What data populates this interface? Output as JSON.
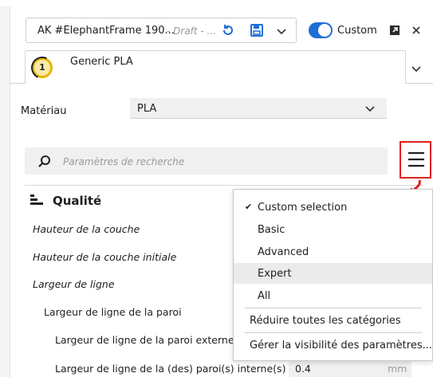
{
  "profile": {
    "name": "AK #ElephantFrame 190...",
    "state": "- Draft - ...",
    "custom_label": "Custom",
    "custom_enabled": true
  },
  "extruder_tab": {
    "badge": "1",
    "label": "Generic PLA"
  },
  "material": {
    "label": "Matériau",
    "value": "PLA"
  },
  "search": {
    "placeholder": "Paramètres de recherche"
  },
  "section": {
    "title": "Qualité"
  },
  "settings": [
    {
      "label": "Hauteur de la couche"
    },
    {
      "label": "Hauteur de la couche initiale"
    },
    {
      "label": "Largeur de ligne"
    },
    {
      "label": "Largeur de ligne de la paroi"
    },
    {
      "label": "Largeur de ligne de la paroi externe"
    },
    {
      "label": "Largeur de ligne de la (des) paroi(s) interne(s)",
      "value": "0.4",
      "unit": "mm"
    }
  ],
  "visibility_menu": {
    "items": [
      {
        "label": "Custom selection",
        "checked": true
      },
      {
        "label": "Basic"
      },
      {
        "label": "Advanced"
      },
      {
        "label": "Expert",
        "highlighted": true
      },
      {
        "label": "All"
      }
    ],
    "collapse_label": "Réduire toutes les catégories",
    "manage_label": "Gérer la visibilité des paramètres..."
  },
  "colors": {
    "accent": "#1f6fd6",
    "annotation": "#e02020",
    "badge": "#e8b500"
  }
}
